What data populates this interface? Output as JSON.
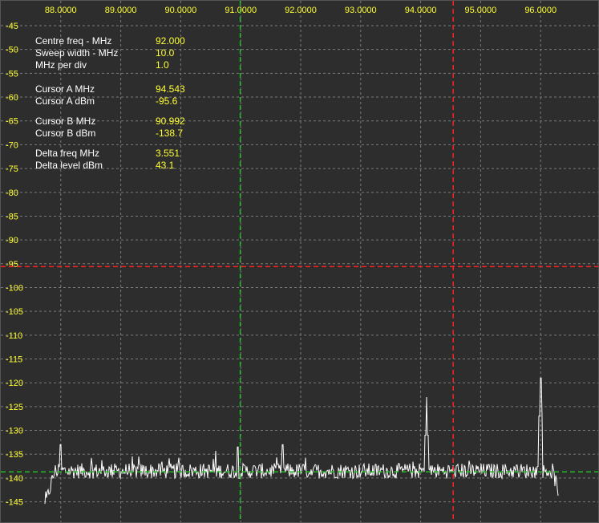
{
  "colors": {
    "background": "#2d2d2d",
    "grid": "#7a7a7a",
    "axis_text": "#ffff33",
    "label_text": "#ffffff",
    "trace": "#ffffff",
    "cursor_a": "#ff2020",
    "cursor_b": "#22bb22"
  },
  "chart_data": {
    "type": "line",
    "x_ticks": [
      "88.0000",
      "89.0000",
      "90.0000",
      "91.0000",
      "92.0000",
      "93.0000",
      "94.0000",
      "95.0000",
      "96.0000"
    ],
    "y_ticks": [
      "-45",
      "-50",
      "-55",
      "-60",
      "-65",
      "-70",
      "-75",
      "-80",
      "-85",
      "-90",
      "-95",
      "-100",
      "-105",
      "-110",
      "-115",
      "-120",
      "-125",
      "-130",
      "-135",
      "-140",
      "-145"
    ],
    "xlim": [
      87.0,
      97.0
    ],
    "ylim": [
      -150,
      -42
    ],
    "grid": true,
    "cursor_a": {
      "freq": 94.543,
      "level": -95.6
    },
    "cursor_b": {
      "freq": 90.992,
      "level": -138.7
    },
    "noise_floor": -138.5,
    "band_edges": [
      87.9,
      96.2
    ],
    "peaks": [
      {
        "freq": 88.0,
        "level": -133
      },
      {
        "freq": 89.3,
        "level": -135.5
      },
      {
        "freq": 90.95,
        "level": -133.5
      },
      {
        "freq": 91.7,
        "level": -133
      },
      {
        "freq": 94.1,
        "level": -123
      },
      {
        "freq": 96.0,
        "level": -119
      }
    ]
  },
  "readout": {
    "centre_freq_label": "Centre freq - MHz",
    "centre_freq_value": "92.000",
    "sweep_width_label": "Sweep width - MHz",
    "sweep_width_value": "10.0",
    "mhz_per_div_label": "MHz per div",
    "mhz_per_div_value": "1.0",
    "cursor_a_mhz_label": "Cursor A MHz",
    "cursor_a_mhz_value": "94.543",
    "cursor_a_dbm_label": "Cursor A dBm",
    "cursor_a_dbm_value": "-95.6",
    "cursor_b_mhz_label": "Cursor B MHz",
    "cursor_b_mhz_value": "90.992",
    "cursor_b_dbm_label": "Cursor B dBm",
    "cursor_b_dbm_value": "-138.7",
    "delta_freq_label": "Delta freq MHz",
    "delta_freq_value": "3.551",
    "delta_level_label": "Delta level dBm",
    "delta_level_value": "43.1"
  }
}
